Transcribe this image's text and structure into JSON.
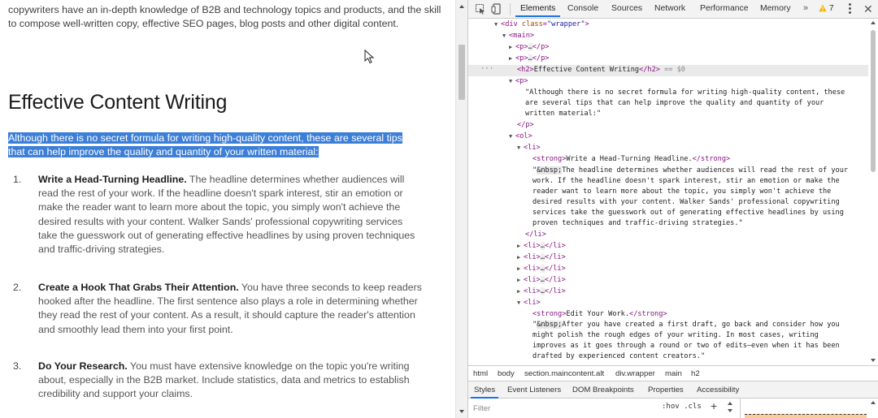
{
  "page": {
    "intro": "copywriters have an in-depth knowledge of B2B and technology topics and products, and the skill to compose well-written copy, effective SEO pages, blog posts and other digital content.",
    "heading": "Effective Content Writing",
    "lead": "Although there is no secret formula for writing high-quality content, these are several tips that can help improve the quality and quantity of your written material:",
    "items": [
      {
        "num": "1.",
        "title": "Write a Head-Turning Headline.",
        "body": " The headline determines whether audiences will read the rest of your work. If the headline doesn't spark interest, stir an emotion or make the reader want to learn more about the topic, you simply won't achieve the desired results with your content. Walker Sands' professional copywriting services take the guesswork out of generating effective headlines by using proven techniques and traffic-driving strategies."
      },
      {
        "num": "2.",
        "title": "Create a Hook That Grabs Their Attention.",
        "body": " You have three seconds to keep readers hooked after the headline. The first sentence also plays a role in determining whether they read the rest of your content. As a result, it should capture the reader's attention and smoothly lead them into your first point."
      },
      {
        "num": "3.",
        "title": "Do Your Research.",
        "body": " You must have extensive knowledge on the topic you're writing about, especially in the B2B market. Include statistics, data and metrics to establish credibility and support your claims."
      }
    ]
  },
  "devtools": {
    "tabs": [
      "Elements",
      "Console",
      "Sources",
      "Network",
      "Performance",
      "Memory"
    ],
    "active_tab": "Elements",
    "more": "»",
    "warning_count": "7",
    "dom": {
      "div_tag": "div",
      "div_attr": "class",
      "div_val": "\"wrapper\"",
      "main": "<main>",
      "p_collapsed": "<p>",
      "p_close": "</p>",
      "ellipsis": "…",
      "h2_open": "<h2>",
      "h2_text": "Effective Content Writing",
      "h2_close": "</h2>",
      "eq0": " == $0",
      "p_open": "<p>",
      "p_text_1": "\"Although there is no secret formula for writing high-quality content, these",
      "p_text_2": "are several tips that can help improve the quality and quantity of your",
      "p_text_3": "written material:\"",
      "ol_open": "<ol>",
      "li_open": "<li>",
      "li_close": "</li>",
      "strong_open": "<strong>",
      "strong_close": "</strong>",
      "li1_strong": "Write a Head-Turning Headline.",
      "nbsp": "&nbsp;",
      "li1_lines": [
        "The headline determines whether audiences will read the rest of your",
        "work. If the headline doesn't spark interest, stir an emotion or make the",
        "reader want to learn more about the topic, you simply won't achieve the",
        "desired results with your content. Walker Sands' professional copywriting",
        "services take the guesswork out of generating effective headlines by using",
        "proven techniques and traffic-driving strategies.\""
      ],
      "li_last_strong": "Edit Your Work.",
      "li_last_lines": [
        "After you have created a first draft, go back and consider how you",
        "might polish the rough edges of your writing. In most cases, writing",
        "improves as it goes through a round or two of edits—even when it has been",
        "drafted by experienced content creators.\""
      ],
      "quote": "\""
    },
    "breadcrumbs": [
      "html",
      "body",
      "section.maincontent.alt",
      "div.wrapper",
      "main",
      "h2"
    ],
    "style_tabs": [
      "Styles",
      "Event Listeners",
      "DOM Breakpoints",
      "Properties",
      "Accessibility"
    ],
    "active_style_tab": "Styles",
    "filter_placeholder": "Filter",
    "hov_cls": ":hov  .cls",
    "plus": "+"
  }
}
